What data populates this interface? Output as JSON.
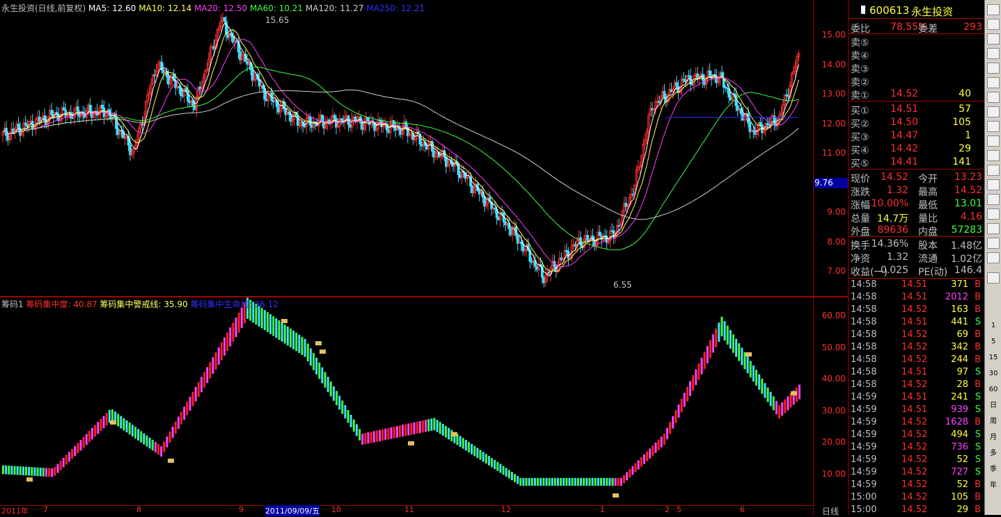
{
  "main_header": {
    "title": "永生投资(日线,前复权)",
    "ma5": "MA5: 12.60",
    "ma10": "MA10: 12.14",
    "ma20": "MA20: 12.50",
    "ma60": "MA60: 10.21",
    "ma120": "MA120: 11.27",
    "ma250": "MA250: 12.21",
    "high_mark": "15.65",
    "low_mark": "6.55"
  },
  "main_axis": [
    "15.00",
    "14.00",
    "13.00",
    "12.00",
    "11.00",
    "10.00",
    "9.00",
    "8.00",
    "7.00"
  ],
  "current_price_tag": "9.76",
  "sub_header": {
    "title": "筹码1",
    "conc": "筹码集中度: 40.87",
    "warn": "筹码集中警戒线: 35.90",
    "life": "筹码集中生命线: 36.12"
  },
  "sub_axis": [
    "60.00",
    "50.00",
    "40.00",
    "30.00",
    "20.00",
    "10.00"
  ],
  "x_axis": [
    "2011年",
    "7",
    "8",
    "9",
    "2011/09/09/五",
    "10",
    "11",
    "12",
    "1",
    "2",
    "5",
    "6"
  ],
  "x_axis_right": "日线",
  "colors": {
    "up": "#ff3030",
    "down": "#40e0ff",
    "ma5": "#ffffff",
    "ma10": "#ffff60",
    "ma20": "#ff40ff",
    "ma60": "#40ff40",
    "ma120": "#d0d0d0",
    "ma250": "#3030ff",
    "accent": "#a00000"
  },
  "panel": {
    "code": "600613",
    "name": "永生投资",
    "weibi_label": "委比",
    "weibi": "78.55%",
    "weicha_label": "委差",
    "weicha": "293",
    "sell": [
      {
        "label": "卖⑤",
        "price": "",
        "vol": ""
      },
      {
        "label": "卖④",
        "price": "",
        "vol": ""
      },
      {
        "label": "卖③",
        "price": "",
        "vol": ""
      },
      {
        "label": "卖②",
        "price": "",
        "vol": ""
      },
      {
        "label": "卖①",
        "price": "14.52",
        "vol": "40"
      }
    ],
    "buy": [
      {
        "label": "买①",
        "price": "14.51",
        "vol": "57"
      },
      {
        "label": "买②",
        "price": "14.50",
        "vol": "105"
      },
      {
        "label": "买③",
        "price": "14.47",
        "vol": "1"
      },
      {
        "label": "买④",
        "price": "14.42",
        "vol": "29"
      },
      {
        "label": "买⑤",
        "price": "14.41",
        "vol": "141"
      }
    ],
    "stats": [
      {
        "l1": "现价",
        "v1": "14.52",
        "c1": "#ff3030",
        "l2": "今开",
        "v2": "13.23",
        "c2": "#ff3030"
      },
      {
        "l1": "涨跌",
        "v1": "1.32",
        "c1": "#ff3030",
        "l2": "最高",
        "v2": "14.52",
        "c2": "#ff3030"
      },
      {
        "l1": "涨幅",
        "v1": "10.00%",
        "c1": "#ff3030",
        "l2": "最低",
        "v2": "13.01",
        "c2": "#40ff40"
      },
      {
        "l1": "总量",
        "v1": "14.7万",
        "c1": "#ffff40",
        "l2": "量比",
        "v2": "4.16",
        "c2": "#ff3030"
      },
      {
        "l1": "外盘",
        "v1": "89636",
        "c1": "#ff3030",
        "l2": "内盘",
        "v2": "57283",
        "c2": "#40ff40"
      }
    ],
    "fund": [
      {
        "l1": "换手",
        "v1": "14.36%",
        "l2": "股本",
        "v2": "1.48亿"
      },
      {
        "l1": "净资",
        "v1": "1.32",
        "l2": "流通",
        "v2": "1.02亿"
      },
      {
        "l1": "收益(一)",
        "v1": "0.025",
        "l2": "PE(动)",
        "v2": "146.4"
      }
    ],
    "ticks": [
      {
        "t": "14:58",
        "p": "14.51",
        "v": "371",
        "s": "B",
        "vc": "#ffff40"
      },
      {
        "t": "14:58",
        "p": "14.51",
        "v": "2012",
        "s": "B",
        "vc": "#ff40ff"
      },
      {
        "t": "14:58",
        "p": "14.52",
        "v": "163",
        "s": "B",
        "vc": "#ffff40"
      },
      {
        "t": "14:58",
        "p": "14.51",
        "v": "441",
        "s": "S",
        "vc": "#ffff40"
      },
      {
        "t": "14:58",
        "p": "14.52",
        "v": "69",
        "s": "B",
        "vc": "#ffff40"
      },
      {
        "t": "14:58",
        "p": "14.52",
        "v": "342",
        "s": "B",
        "vc": "#ffff40"
      },
      {
        "t": "14:58",
        "p": "14.52",
        "v": "244",
        "s": "B",
        "vc": "#ffff40"
      },
      {
        "t": "14:58",
        "p": "14.51",
        "v": "97",
        "s": "S",
        "vc": "#ffff40"
      },
      {
        "t": "14:58",
        "p": "14.52",
        "v": "28",
        "s": "B",
        "vc": "#ffff40"
      },
      {
        "t": "14:59",
        "p": "14.51",
        "v": "241",
        "s": "S",
        "vc": "#ffff40"
      },
      {
        "t": "14:59",
        "p": "14.51",
        "v": "939",
        "s": "S",
        "vc": "#ff40ff"
      },
      {
        "t": "14:59",
        "p": "14.52",
        "v": "1628",
        "s": "B",
        "vc": "#ff40ff"
      },
      {
        "t": "14:59",
        "p": "14.52",
        "v": "494",
        "s": "S",
        "vc": "#ffff40"
      },
      {
        "t": "14:59",
        "p": "14.52",
        "v": "736",
        "s": "S",
        "vc": "#ff40ff"
      },
      {
        "t": "14:59",
        "p": "14.52",
        "v": "52",
        "s": "S",
        "vc": "#ffff40"
      },
      {
        "t": "14:59",
        "p": "14.52",
        "v": "727",
        "s": "S",
        "vc": "#ff40ff"
      },
      {
        "t": "14:59",
        "p": "14.52",
        "v": "52",
        "s": "B",
        "vc": "#ffff40"
      },
      {
        "t": "15:00",
        "p": "14.52",
        "v": "105",
        "s": "B",
        "vc": "#ffff40"
      },
      {
        "t": "15:00",
        "p": "14.52",
        "v": "29",
        "s": "B",
        "vc": "#ffff40"
      }
    ]
  },
  "toolbar": [
    "1",
    "5",
    "15",
    "30",
    "60",
    "日",
    "周",
    "月",
    "多",
    "季",
    "年"
  ],
  "toolbar_icons": [
    "chart-line-icon",
    "chart-bar-icon",
    "list-icon",
    "table-icon",
    "f10-icon",
    "f11-icon",
    "f12-icon",
    "grid-icon",
    "window-icon",
    "rsi-icon",
    "tool-icon",
    "tool2-icon",
    "tool3-icon",
    "arrow-up-icon",
    "arrow-down-icon",
    "arrow-left-icon",
    "arrow-right-icon",
    "f5-icon",
    "n-icon"
  ]
}
